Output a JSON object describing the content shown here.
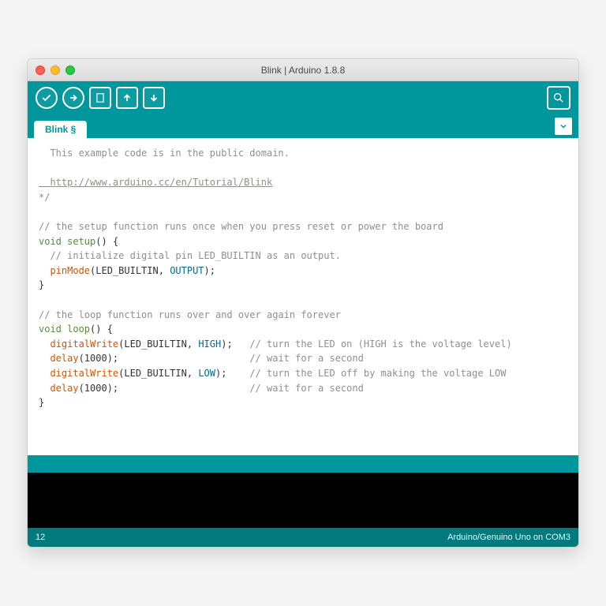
{
  "window": {
    "title": "Blink | Arduino 1.8.8"
  },
  "tab": {
    "label": "Blink §"
  },
  "toolbar": {
    "verify": "verify",
    "upload": "upload",
    "new": "new",
    "open": "open",
    "save": "save",
    "serial": "serial-monitor"
  },
  "code": {
    "l1": "  This example code is in the public domain.",
    "l2": "  http://www.arduino.cc/en/Tutorial/Blink",
    "l3": "*/",
    "l4": "// the setup function runs once when you press reset or power the board",
    "l5a": "void",
    "l5b": " setup",
    "l5c": "() {",
    "l6": "  // initialize digital pin LED_BUILTIN as an output.",
    "l7a": "  pinMode",
    "l7b": "(LED_BUILTIN, ",
    "l7c": "OUTPUT",
    "l7d": ");",
    "l8": "}",
    "l9": "// the loop function runs over and over again forever",
    "l10a": "void",
    "l10b": " loop",
    "l10c": "() {",
    "l11a": "  digitalWrite",
    "l11b": "(LED_BUILTIN, ",
    "l11c": "HIGH",
    "l11d": ");",
    "l11e": "   // turn the LED on (HIGH is the voltage level)",
    "l12a": "  delay",
    "l12b": "(1000);",
    "l12c": "                       // wait for a second",
    "l13a": "  digitalWrite",
    "l13b": "(LED_BUILTIN, ",
    "l13c": "LOW",
    "l13d": ");",
    "l13e": "    // turn the LED off by making the voltage LOW",
    "l14a": "  delay",
    "l14b": "(1000);",
    "l14c": "                       // wait for a second",
    "l15": "}"
  },
  "status": {
    "message": ""
  },
  "foot": {
    "line": "12",
    "board": "Arduino/Genuino Uno on COM3"
  }
}
